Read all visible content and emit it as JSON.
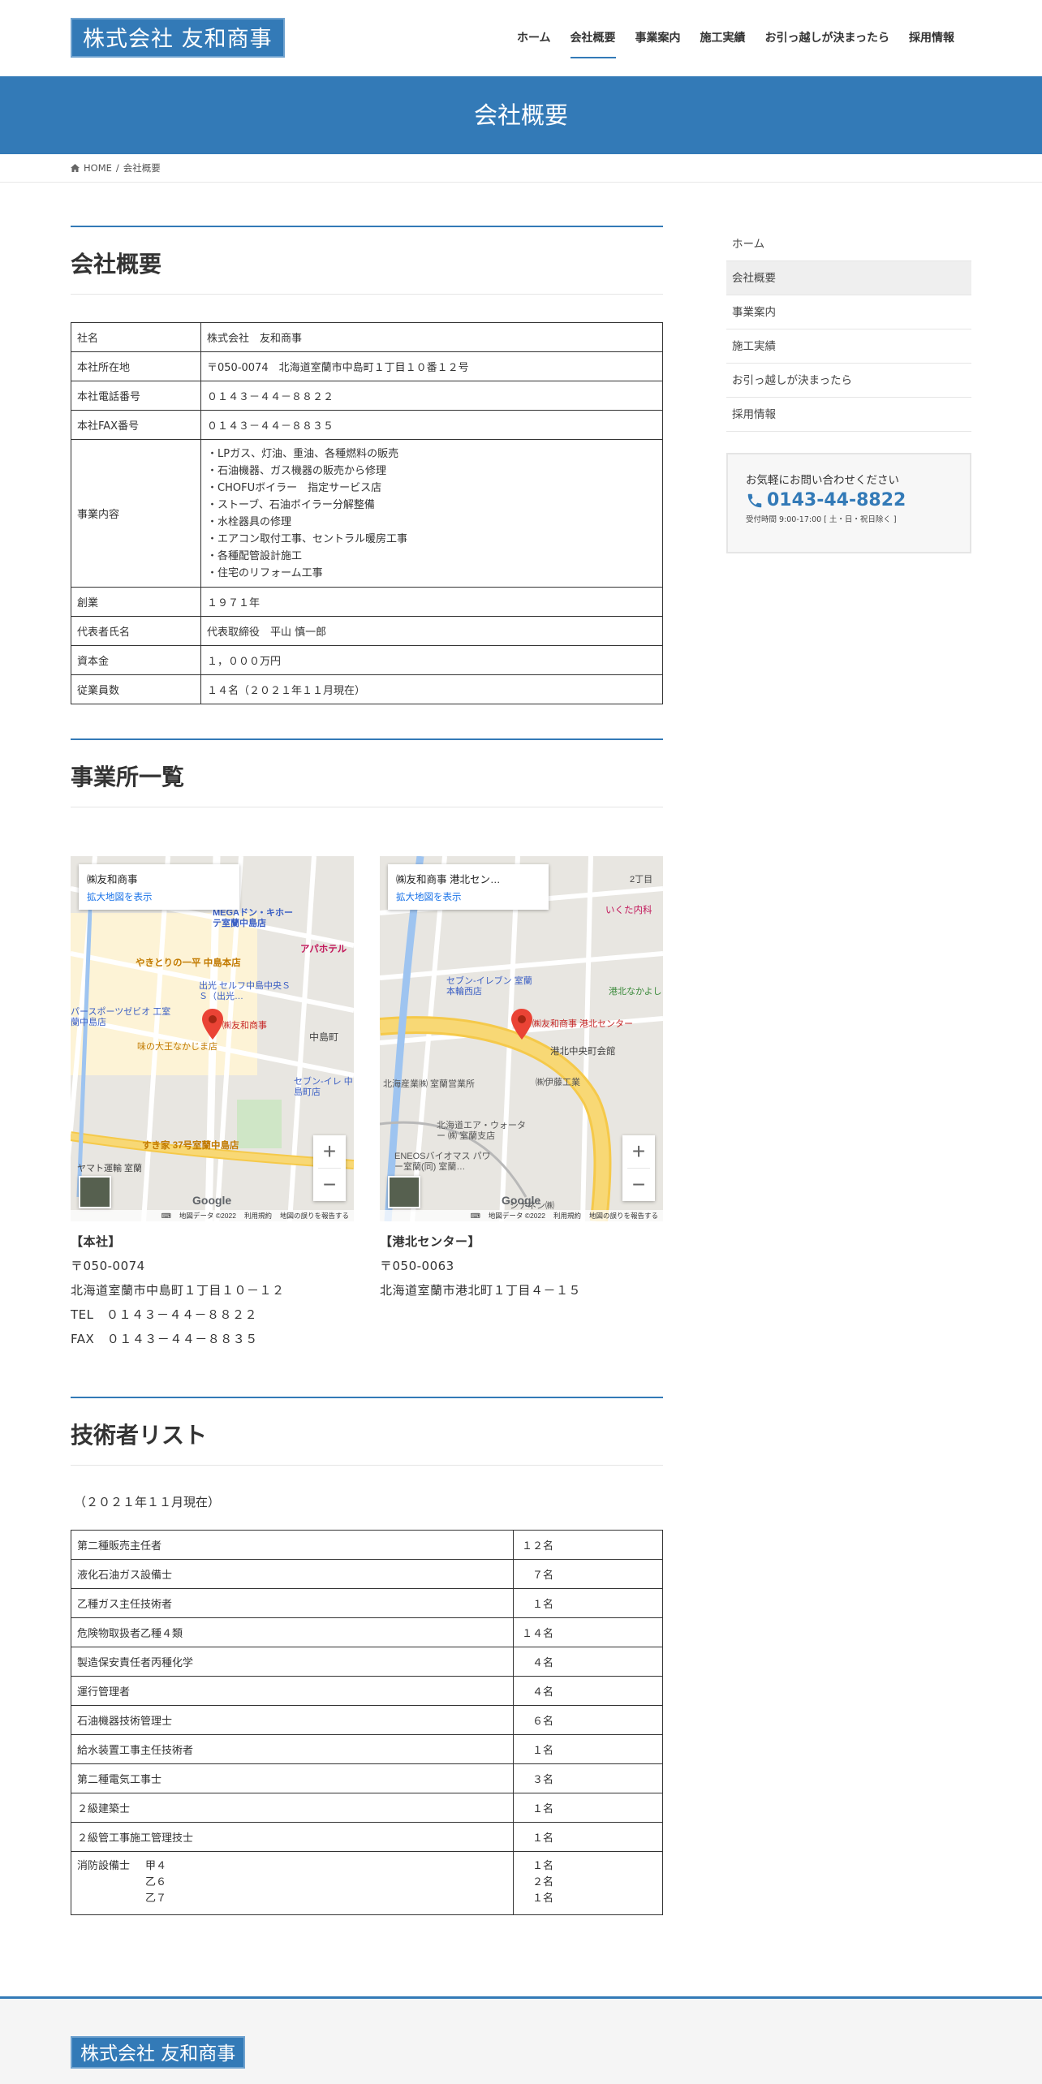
{
  "header": {
    "logo": "株式会社 友和商事",
    "nav": [
      "ホーム",
      "会社概要",
      "事業案内",
      "施工実績",
      "お引っ越しが決まったら",
      "採用情報"
    ]
  },
  "page_title": "会社概要",
  "breadcrumb": {
    "home": "HOME",
    "current": "会社概要"
  },
  "company": {
    "title": "会社概要",
    "rows": [
      {
        "label": "社名",
        "value": "株式会社　友和商事"
      },
      {
        "label": "本社所在地",
        "value": "〒050-0074　北海道室蘭市中島町１丁目１０番１２号"
      },
      {
        "label": "本社電話番号",
        "value": "０１４３－４４－８８２２"
      },
      {
        "label": "本社FAX番号",
        "value": "０１４３－４４－８８３５"
      },
      {
        "label": "事業内容",
        "lines": [
          "・LPガス、灯油、重油、各種燃料の販売",
          "・石油機器、ガス機器の販売から修理",
          "・CHOFUボイラー　指定サービス店",
          "・ストーブ、石油ボイラー分解整備",
          "・水栓器具の修理",
          "・エアコン取付工事、セントラル暖房工事",
          "・各種配管設計施工",
          "・住宅のリフォーム工事"
        ]
      },
      {
        "label": "創業",
        "value": "１９７１年"
      },
      {
        "label": "代表者氏名",
        "value": "代表取締役　平山 慎一郎"
      },
      {
        "label": "資本金",
        "value": "１，０００万円"
      },
      {
        "label": "従業員数",
        "value": "１４名（２０２１年１１月現在）"
      }
    ]
  },
  "offices": {
    "title": "事業所一覧",
    "items": [
      {
        "map_name": "㈱友和商事",
        "map_link": "拡大地図を表示",
        "map_labels": [
          "MEGAドン・キホーテ室蘭中島店",
          "やきとりの一平 中島本店",
          "アパホテル",
          "出光 セルフ中島中央ＳＳ（出光…",
          "味の大王なかじま店",
          "中島町",
          "㈱友和商事",
          "すき家 37号室蘭中島店",
          "パースポーツゼビオ 工室蘭中島店",
          "セブン-イレ 中島町店",
          "ヤマト運輸 室蘭"
        ],
        "addr_title": "【本社】",
        "addr_lines": [
          "〒050-0074",
          "北海道室蘭市中島町１丁目１０－１２",
          "TEL　０１４３－４４－８８２２",
          "FAX　０１４３－４４－８８３５"
        ]
      },
      {
        "map_name": "㈱友和商事 港北セン…",
        "map_link": "拡大地図を表示",
        "map_labels": [
          "2丁目",
          "いくた内科",
          "セブン-イレブン 室蘭本輪西店",
          "港北なかよし",
          "㈱友和商事 港北センター",
          "港北中央町会館",
          "北海産業㈱ 室蘭営業所",
          "㈱伊藤工業",
          "北海道エア・ウォーター ㈱ 室蘭支店",
          "ENEOSバイオマス パワー室蘭(同) 室蘭…",
          "シナネン㈱"
        ],
        "addr_title": "【港北センター】",
        "addr_lines": [
          "〒050-0063",
          "北海道室蘭市港北町１丁目４－１５"
        ]
      }
    ],
    "map_footer": [
      "地図データ ©2022",
      "利用規約",
      "地図の誤りを報告する"
    ],
    "google": "Google"
  },
  "engineers": {
    "title": "技術者リスト",
    "note": "（２０２１年１１月現在）",
    "rows": [
      {
        "name": "第二種販売主任者",
        "count": "１２名"
      },
      {
        "name": "液化石油ガス設備士",
        "count": "　７名"
      },
      {
        "name": "乙種ガス主任技術者",
        "count": "　１名"
      },
      {
        "name": "危険物取扱者乙種４類",
        "count": "１４名"
      },
      {
        "name": "製造保安責任者丙種化学",
        "count": "　４名"
      },
      {
        "name": "運行管理者",
        "count": "　４名"
      },
      {
        "name": "石油機器技術管理士",
        "count": "　６名"
      },
      {
        "name": "給水装置工事主任技術者",
        "count": "　１名"
      },
      {
        "name": "第二種電気工事士",
        "count": "　３名"
      },
      {
        "name": "２級建築士",
        "count": "　１名"
      },
      {
        "name": "２級管工事施工管理技士",
        "count": "　１名"
      }
    ],
    "fire": {
      "name": "消防設備士",
      "sub": [
        "甲４",
        "乙６",
        "乙７"
      ],
      "counts": [
        "　１名",
        "　２名",
        "　１名"
      ]
    }
  },
  "sidebar": {
    "nav": [
      "ホーム",
      "会社概要",
      "事業案内",
      "施工実績",
      "お引っ越しが決まったら",
      "採用情報"
    ],
    "contact_title": "お気軽にお問い合わせください",
    "tel": "0143-44-8822",
    "hours": "受付時間 9:00-17:00 [ 土・日・祝日除く ]"
  },
  "footer": {
    "logo": "株式会社 友和商事"
  },
  "colors": {
    "brand": "#337ab7"
  }
}
